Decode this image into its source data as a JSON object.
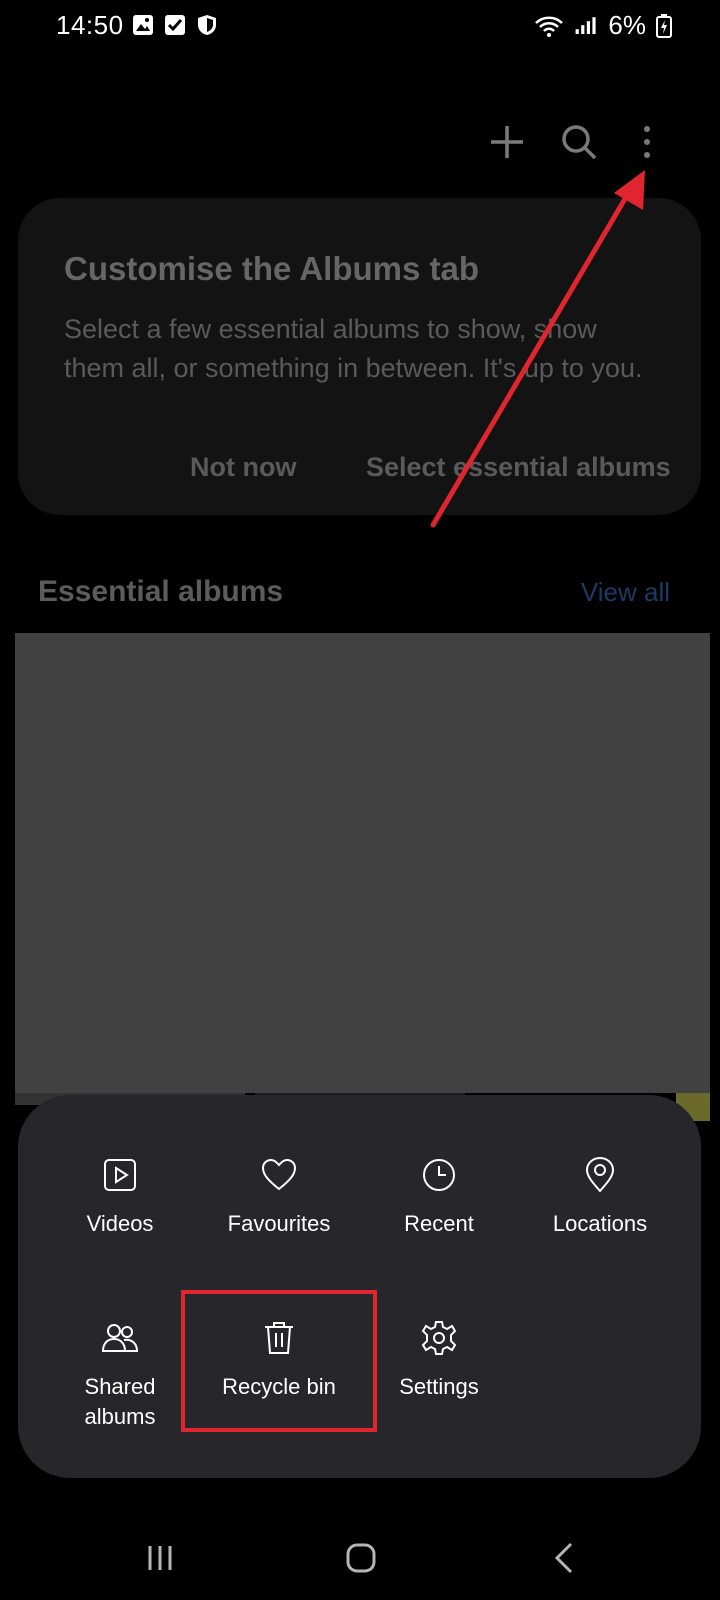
{
  "status_bar": {
    "time": "14:50",
    "battery": "6%"
  },
  "top_actions": {
    "icons": [
      "plus-icon",
      "search-icon",
      "more-vertical-icon"
    ]
  },
  "card": {
    "title": "Customise the Albums tab",
    "body": "Select a few essential albums to show, show them all, or something in between. It's up to you.",
    "not_now": "Not now",
    "select": "Select essential albums"
  },
  "section": {
    "title": "Essential albums",
    "view_all": "View all"
  },
  "menu": {
    "items": [
      {
        "label": "Videos",
        "icon": "video-icon"
      },
      {
        "label": "Favourites",
        "icon": "heart-icon"
      },
      {
        "label": "Recent",
        "icon": "clock-icon"
      },
      {
        "label": "Locations",
        "icon": "location-pin-icon"
      },
      {
        "label": "Shared\nalbums",
        "icon": "shared-people-icon"
      },
      {
        "label": "Recycle bin",
        "icon": "trash-icon"
      },
      {
        "label": "Settings",
        "icon": "gear-icon"
      }
    ]
  },
  "colors": {
    "highlight": "#e0252f",
    "arrow": "#e0252f",
    "accent_link": "#1d3a66"
  }
}
